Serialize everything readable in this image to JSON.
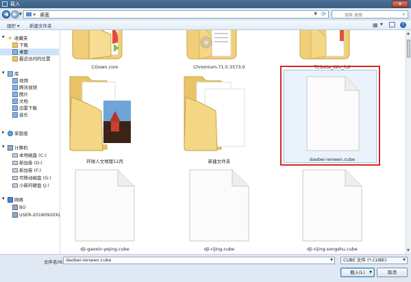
{
  "window": {
    "title": "载入",
    "close_label": "✕"
  },
  "address": {
    "path": "桌面",
    "separator": "▸",
    "search_placeholder": "搜索 桌面"
  },
  "toolbar": {
    "organize": "组织 ▾",
    "new_folder": "新建文件夹"
  },
  "sidebar": {
    "favorites": "收藏夹",
    "downloads": "下载",
    "desktop": "桌面",
    "recent": "最近访问的位置",
    "libraries": "库",
    "videos": "视频",
    "tencent_videos": "腾讯视频",
    "pictures": "图片",
    "documents": "文档",
    "thunder_downloads": "迅雷下载",
    "music": "音乐",
    "homegroup": "家庭组",
    "computer": "计算机",
    "local_disk_c": "本地磁盘 (C:)",
    "new_volume_d": "新加卷 (D:)",
    "new_volume_f": "新加卷 (F:)",
    "removable_g": "可移动磁盘 (G:)",
    "disk_j": "小新的硬盘 (J:)",
    "network": "网络",
    "net_bo": "BO",
    "net_user": "USER-20180920XL"
  },
  "files": [
    {
      "name": "CGown.com",
      "kind": "folder-partial"
    },
    {
      "name": "Chromium-71.0.3573.0",
      "kind": "folder-partial"
    },
    {
      "name": "TCSuite_Win_full",
      "kind": "folder-partial"
    },
    {
      "name": "环球人文地理12月",
      "kind": "folder-photo"
    },
    {
      "name": "新建文件夹",
      "kind": "folder"
    },
    {
      "name": "daobei-renwen.cube",
      "kind": "file",
      "selected": true
    },
    {
      "name": "dji-gaoxin-yejing.cube",
      "kind": "file"
    },
    {
      "name": "dji-rijing.cube",
      "kind": "file"
    },
    {
      "name": "dji-rijing-songshu.cube",
      "kind": "file"
    }
  ],
  "footer": {
    "filename_label": "文件名(N):",
    "filename_value": "daobei-renwen.cube",
    "filetype": "CUBE 文件 (*.CUBE)",
    "open_button": "载入(L)",
    "cancel_button": "取消"
  },
  "colors": {
    "selection_highlight": "#d82424",
    "folder_yellow": "#f2d27a"
  }
}
